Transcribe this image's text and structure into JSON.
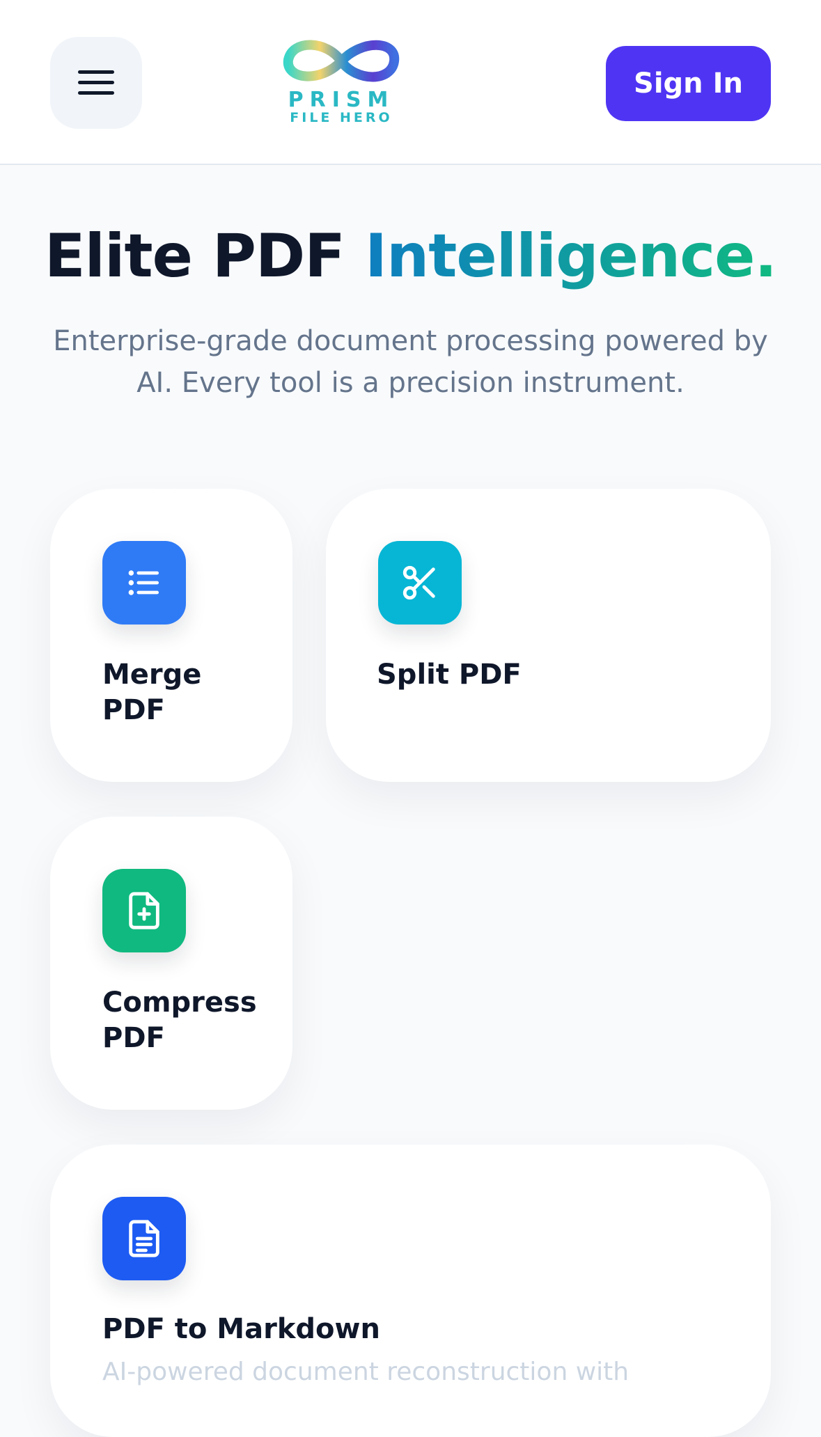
{
  "header": {
    "menu_icon": "hamburger-menu-icon",
    "logo": {
      "line1": "PRISM",
      "line2": "FILE HERO"
    },
    "sign_in_label": "Sign In",
    "accent_color": "#4f35f3"
  },
  "hero": {
    "title_plain": "Elite PDF ",
    "title_accent": "Intelligence.",
    "subtitle": "Enterprise-grade document processing powered by AI. Every tool is a precision instrument."
  },
  "tools": [
    {
      "title": "Merge PDF",
      "icon": "list-icon",
      "color": "#2f7bf6"
    },
    {
      "title": "Split PDF",
      "icon": "scissors-icon",
      "color": "#07b6d5"
    },
    {
      "title": "Compress PDF",
      "icon": "file-plus-icon",
      "color": "#10b97f"
    },
    {
      "title": "PDF to Markdown",
      "icon": "document-text-icon",
      "color": "#1d5bf2",
      "description": "AI-powered document reconstruction with"
    }
  ]
}
